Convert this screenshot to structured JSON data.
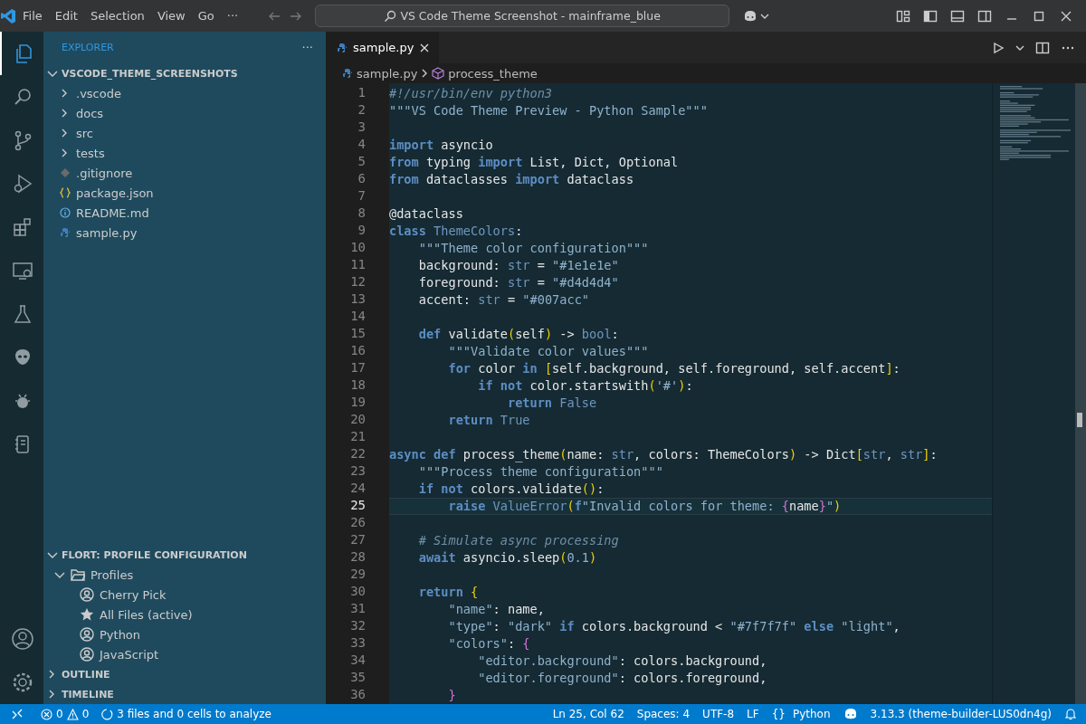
{
  "title_bar": {
    "menu": [
      "File",
      "Edit",
      "Selection",
      "View",
      "Go",
      "···"
    ],
    "search": {
      "value": "VS Code Theme Screenshot - mainframe_blue"
    }
  },
  "activity_bar": {
    "items": [
      {
        "kind": "explorer",
        "selected": true
      },
      {
        "kind": "search",
        "selected": false
      },
      {
        "kind": "scm",
        "selected": false
      },
      {
        "kind": "debug",
        "selected": false
      },
      {
        "kind": "extensions",
        "selected": false
      },
      {
        "kind": "remote",
        "selected": false
      },
      {
        "kind": "testing",
        "selected": false
      },
      {
        "kind": "alien",
        "selected": false
      },
      {
        "kind": "bug",
        "selected": false
      },
      {
        "kind": "notebook",
        "selected": false
      }
    ]
  },
  "sidebar": {
    "title": "EXPLORER",
    "more": "···",
    "folder": {
      "label": "VSCODE_THEME_SCREENSHOTS",
      "expanded": true,
      "items": [
        {
          "kind": "folder",
          "label": ".vscode"
        },
        {
          "kind": "folder",
          "label": "docs"
        },
        {
          "kind": "folder",
          "label": "src"
        },
        {
          "kind": "folder",
          "label": "tests"
        },
        {
          "kind": "gitignore",
          "label": ".gitignore"
        },
        {
          "kind": "json",
          "label": "package.json"
        },
        {
          "kind": "info",
          "label": "README.md"
        },
        {
          "kind": "python",
          "label": "sample.py"
        }
      ]
    },
    "profile_section": {
      "label": "FLORT: PROFILE CONFIGURATION",
      "expanded": true,
      "group": {
        "label": "Profiles",
        "expanded": true,
        "children": [
          {
            "kind": "profile",
            "label": "Cherry Pick"
          },
          {
            "kind": "active",
            "label": "All Files (active)"
          },
          {
            "kind": "profile",
            "label": "Python"
          },
          {
            "kind": "profile",
            "label": "JavaScript"
          }
        ]
      }
    },
    "collapsed_sections": [
      {
        "label": "OUTLINE",
        "expanded": false
      },
      {
        "label": "TIMELINE",
        "expanded": false
      }
    ]
  },
  "tabs": [
    {
      "label": "sample.py",
      "selected": true
    }
  ],
  "breadcrumbs": [
    "sample.py",
    "process_theme"
  ],
  "editor": {
    "lines": [
      {
        "number": "1",
        "active": false,
        "tokens": [
          {
            "kind": "comment",
            "text": "#!/usr/bin/env python3"
          }
        ]
      },
      {
        "number": "2",
        "active": false,
        "tokens": [
          {
            "kind": "string",
            "text": "\"\"\"VS Code Theme Preview - Python Sample\"\"\""
          }
        ]
      },
      {
        "number": "3",
        "active": false
      },
      {
        "number": "4",
        "active": false,
        "tokens": [
          {
            "kind": "keyword",
            "text": "import"
          },
          {
            "kind": "plain",
            "text": " asyncio"
          }
        ]
      },
      {
        "number": "5",
        "active": false,
        "tokens": [
          {
            "kind": "keyword",
            "text": "from"
          },
          {
            "kind": "plain",
            "text": " typing "
          },
          {
            "kind": "keyword",
            "text": "import"
          },
          {
            "kind": "plain",
            "text": " List, Dict, Optional"
          }
        ]
      },
      {
        "number": "6",
        "active": false,
        "tokens": [
          {
            "kind": "keyword",
            "text": "from"
          },
          {
            "kind": "plain",
            "text": " dataclasses "
          },
          {
            "kind": "keyword",
            "text": "import"
          },
          {
            "kind": "plain",
            "text": " dataclass"
          }
        ]
      },
      {
        "number": "7",
        "active": false
      },
      {
        "number": "8",
        "active": false,
        "tokens": [
          {
            "kind": "plain",
            "text": "@dataclass"
          }
        ]
      },
      {
        "number": "9",
        "active": false,
        "tokens": [
          {
            "kind": "keyword",
            "text": "class"
          },
          {
            "kind": "type",
            "text": " ThemeColors"
          },
          {
            "kind": "plain",
            "text": ":"
          }
        ]
      },
      {
        "number": "10",
        "active": false,
        "tokens": [
          {
            "kind": "string",
            "text": "    \"\"\"Theme color configuration\"\"\""
          }
        ]
      },
      {
        "number": "11",
        "active": false,
        "tokens": [
          {
            "kind": "plain",
            "text": "    background: "
          },
          {
            "kind": "type",
            "text": "str"
          },
          {
            "kind": "plain",
            "text": " = "
          },
          {
            "kind": "string",
            "text": "\"#1e1e1e\""
          }
        ]
      },
      {
        "number": "12",
        "active": false,
        "tokens": [
          {
            "kind": "plain",
            "text": "    foreground: "
          },
          {
            "kind": "type",
            "text": "str"
          },
          {
            "kind": "plain",
            "text": " = "
          },
          {
            "kind": "string",
            "text": "\"#d4d4d4\""
          }
        ]
      },
      {
        "number": "13",
        "active": false,
        "tokens": [
          {
            "kind": "plain",
            "text": "    accent: "
          },
          {
            "kind": "type",
            "text": "str"
          },
          {
            "kind": "plain",
            "text": " = "
          },
          {
            "kind": "string",
            "text": "\"#007acc\""
          }
        ]
      },
      {
        "number": "14",
        "active": false
      },
      {
        "number": "15",
        "active": false,
        "tokens": [
          {
            "kind": "keyword",
            "text": "    def"
          },
          {
            "kind": "plain",
            "text": " validate"
          },
          {
            "kind": "bracket",
            "text": "("
          },
          {
            "kind": "plain",
            "text": "self"
          },
          {
            "kind": "bracket",
            "text": ")"
          },
          {
            "kind": "plain",
            "text": " -> "
          },
          {
            "kind": "type",
            "text": "bool"
          },
          {
            "kind": "plain",
            "text": ":"
          }
        ]
      },
      {
        "number": "16",
        "active": false,
        "tokens": [
          {
            "kind": "string",
            "text": "        \"\"\"Validate color values\"\"\""
          }
        ]
      },
      {
        "number": "17",
        "active": false,
        "tokens": [
          {
            "kind": "keyword",
            "text": "        for"
          },
          {
            "kind": "plain",
            "text": " color "
          },
          {
            "kind": "keyword",
            "text": "in"
          },
          {
            "kind": "bracket",
            "text": " ["
          },
          {
            "kind": "plain",
            "text": "self.background, self.foreground, self.accent"
          },
          {
            "kind": "bracket",
            "text": "]"
          },
          {
            "kind": "plain",
            "text": ":"
          }
        ]
      },
      {
        "number": "18",
        "active": false,
        "tokens": [
          {
            "kind": "keyword",
            "text": "            if not"
          },
          {
            "kind": "plain",
            "text": " color.startswith"
          },
          {
            "kind": "bracket",
            "text": "("
          },
          {
            "kind": "string",
            "text": "'#'"
          },
          {
            "kind": "bracket",
            "text": ")"
          },
          {
            "kind": "plain",
            "text": ":"
          }
        ]
      },
      {
        "number": "19",
        "active": false,
        "tokens": [
          {
            "kind": "keyword",
            "text": "                return"
          },
          {
            "kind": "type",
            "text": " False"
          }
        ]
      },
      {
        "number": "20",
        "active": false,
        "tokens": [
          {
            "kind": "keyword",
            "text": "        return"
          },
          {
            "kind": "type",
            "text": " True"
          }
        ]
      },
      {
        "number": "21",
        "active": false
      },
      {
        "number": "22",
        "active": false,
        "tokens": [
          {
            "kind": "keyword",
            "text": "async def"
          },
          {
            "kind": "plain",
            "text": " process_theme"
          },
          {
            "kind": "bracket",
            "text": "("
          },
          {
            "kind": "plain",
            "text": "name: "
          },
          {
            "kind": "type",
            "text": "str"
          },
          {
            "kind": "plain",
            "text": ", colors: ThemeColors"
          },
          {
            "kind": "bracket",
            "text": ")"
          },
          {
            "kind": "plain",
            "text": " -> Dict"
          },
          {
            "kind": "bracket",
            "text": "["
          },
          {
            "kind": "type",
            "text": "str"
          },
          {
            "kind": "plain",
            "text": ", "
          },
          {
            "kind": "type",
            "text": "str"
          },
          {
            "kind": "bracket",
            "text": "]"
          },
          {
            "kind": "plain",
            "text": ":"
          }
        ]
      },
      {
        "number": "23",
        "active": false,
        "tokens": [
          {
            "kind": "string",
            "text": "    \"\"\"Process theme configuration\"\"\""
          }
        ]
      },
      {
        "number": "24",
        "active": false,
        "tokens": [
          {
            "kind": "keyword",
            "text": "    if not"
          },
          {
            "kind": "plain",
            "text": " colors.validate"
          },
          {
            "kind": "bracket",
            "text": "()"
          },
          {
            "kind": "plain",
            "text": ":"
          }
        ]
      },
      {
        "number": "25",
        "active": true,
        "tokens": [
          {
            "kind": "keyword",
            "text": "        raise"
          },
          {
            "kind": "type",
            "text": " ValueError"
          },
          {
            "kind": "bracket",
            "text": "("
          },
          {
            "kind": "keyword",
            "text": "f"
          },
          {
            "kind": "string",
            "text": "\"Invalid colors for theme: "
          },
          {
            "kind": "brace",
            "text": "{"
          },
          {
            "kind": "plain",
            "text": "name"
          },
          {
            "kind": "brace",
            "text": "}"
          },
          {
            "kind": "string",
            "text": "\""
          },
          {
            "kind": "bracket",
            "text": ")"
          }
        ]
      },
      {
        "number": "26",
        "active": false
      },
      {
        "number": "27",
        "active": false,
        "tokens": [
          {
            "kind": "comment",
            "text": "    # Simulate async processing"
          }
        ]
      },
      {
        "number": "28",
        "active": false,
        "tokens": [
          {
            "kind": "keyword",
            "text": "    await"
          },
          {
            "kind": "plain",
            "text": " asyncio.sleep"
          },
          {
            "kind": "bracket",
            "text": "("
          },
          {
            "kind": "string",
            "text": "0.1"
          },
          {
            "kind": "bracket",
            "text": ")"
          }
        ]
      },
      {
        "number": "29",
        "active": false
      },
      {
        "number": "30",
        "active": false,
        "tokens": [
          {
            "kind": "keyword",
            "text": "    return"
          },
          {
            "kind": "bracket",
            "text": " {"
          }
        ]
      },
      {
        "number": "31",
        "active": false,
        "tokens": [
          {
            "kind": "string",
            "text": "        \"name\""
          },
          {
            "kind": "plain",
            "text": ": name,"
          }
        ]
      },
      {
        "number": "32",
        "active": false,
        "tokens": [
          {
            "kind": "string",
            "text": "        \"type\""
          },
          {
            "kind": "plain",
            "text": ": "
          },
          {
            "kind": "string",
            "text": "\"dark\""
          },
          {
            "kind": "keyword",
            "text": " if"
          },
          {
            "kind": "plain",
            "text": " colors.background < "
          },
          {
            "kind": "string",
            "text": "\"#7f7f7f\""
          },
          {
            "kind": "keyword",
            "text": " else"
          },
          {
            "kind": "string",
            "text": " \"light\""
          },
          {
            "kind": "plain",
            "text": ","
          }
        ]
      },
      {
        "number": "33",
        "active": false,
        "tokens": [
          {
            "kind": "string",
            "text": "        \"colors\""
          },
          {
            "kind": "plain",
            "text": ": "
          },
          {
            "kind": "brace",
            "text": "{"
          }
        ]
      },
      {
        "number": "34",
        "active": false,
        "tokens": [
          {
            "kind": "string",
            "text": "            \"editor.background\""
          },
          {
            "kind": "plain",
            "text": ": colors.background,"
          }
        ]
      },
      {
        "number": "35",
        "active": false,
        "tokens": [
          {
            "kind": "string",
            "text": "            \"editor.foreground\""
          },
          {
            "kind": "plain",
            "text": ": colors.foreground,"
          }
        ]
      },
      {
        "number": "36",
        "active": false,
        "tokens": [
          {
            "kind": "brace",
            "text": "        }"
          }
        ]
      }
    ]
  },
  "status_bar": {
    "errors": "0",
    "warnings": "0",
    "analysis": "3 files and 0 cells to analyze",
    "cursor": "Ln 25, Col 62",
    "indent": "Spaces: 4",
    "encoding": "UTF-8",
    "eol": "LF",
    "language_icon": "{}",
    "language": "Python",
    "interpreter": "3.13.3 (theme-builder-LUS0dn4g)"
  }
}
